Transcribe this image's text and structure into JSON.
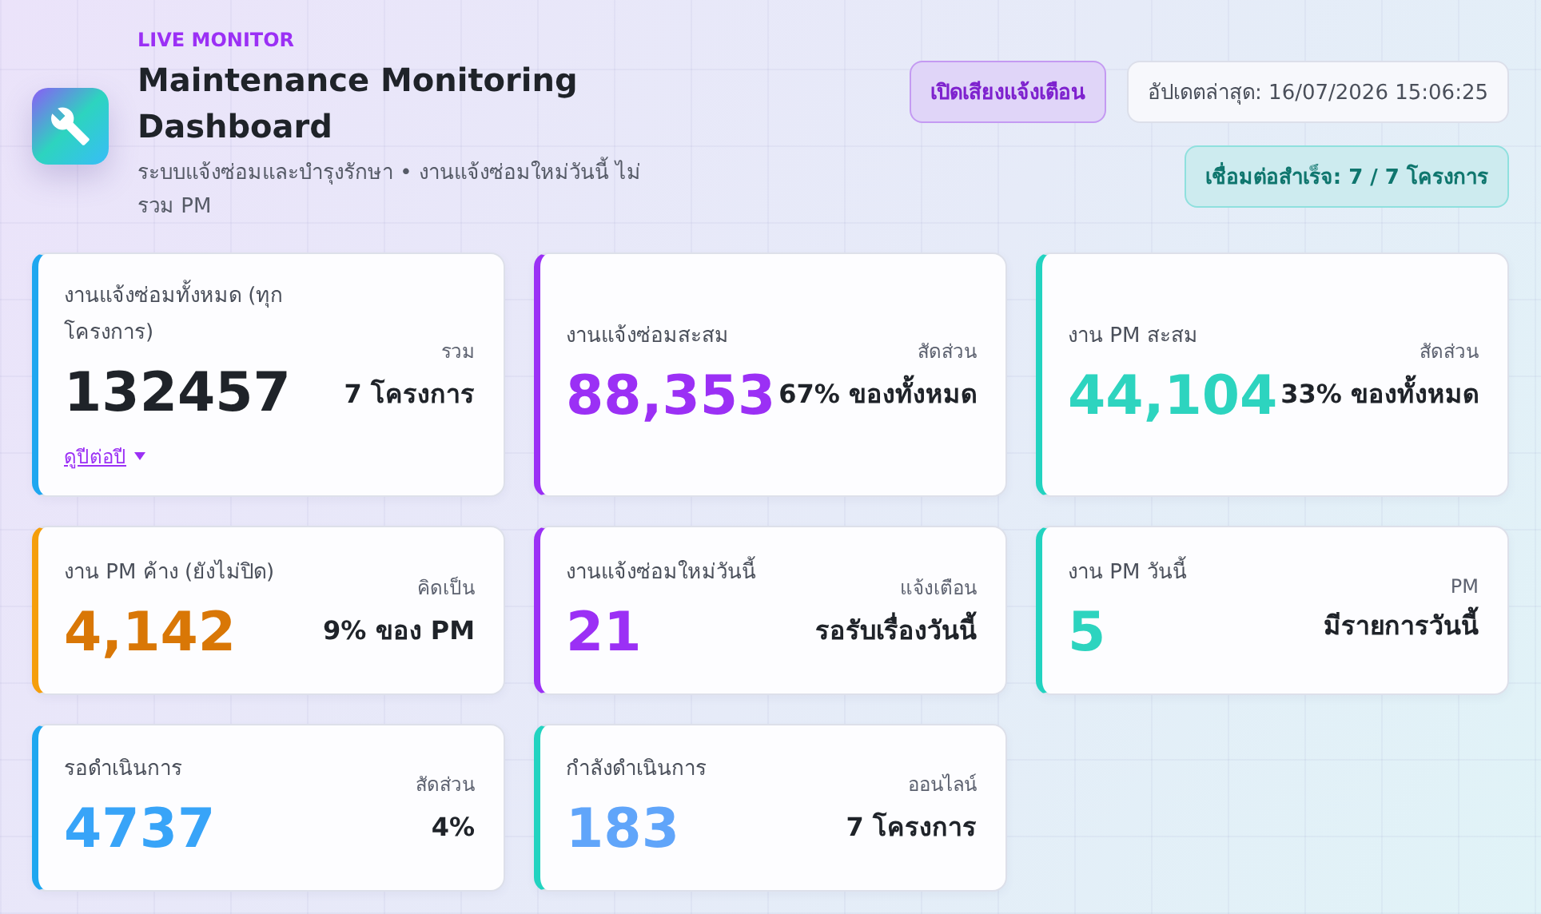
{
  "header": {
    "eyebrow": "LIVE MONITOR",
    "title": "Maintenance Monitoring Dashboard",
    "subtitle": "ระบบแจ้งซ่อมและบำรุงรักษา • งานแจ้งซ่อมใหม่วันนี้ ไม่รวม PM",
    "sound_button": "เปิดเสียงแจ้งเตือน",
    "last_updated": "อัปเดตล่าสุด: 16/07/2026 15:06:25",
    "connection": "เชื่อมต่อสำเร็จ: 7 / 7 โครงการ"
  },
  "cards": [
    {
      "kind": "total",
      "title": "งานแจ้งซ่อมทั้งหมด (ทุกโครงการ)",
      "value": "132457",
      "side_label": "รวม",
      "side_value": "7 โครงการ",
      "color": "#1ea7f0",
      "link": "ดูปีต่อปี"
    },
    {
      "kind": "repair",
      "title": "งานแจ้งซ่อมสะสม",
      "value": "88,353",
      "side_label": "สัดส่วน",
      "side_value": "67% ของทั้งหมด",
      "color": "#9b30f5"
    },
    {
      "kind": "pm",
      "title": "งาน PM สะสม",
      "value": "44,104",
      "side_label": "สัดส่วน",
      "side_value": "33% ของทั้งหมด",
      "color": "#22d3c0"
    },
    {
      "kind": "overdue",
      "title": "งาน PM ค้าง (ยังไม่ปิด)",
      "value": "4,142",
      "side_label": "คิดเป็น",
      "side_value": "9% ของ PM",
      "color": "#f59e0b"
    },
    {
      "kind": "repair",
      "title": "งานแจ้งซ่อมใหม่วันนี้",
      "value": "21",
      "side_label": "แจ้งเตือน",
      "side_value": "รอรับเรื่องวันนี้",
      "color": "#9b30f5"
    },
    {
      "kind": "pm",
      "title": "งาน PM วันนี้",
      "value": "5",
      "side_label": "PM",
      "side_value": "มีรายการวันนี้",
      "color": "#22d3c0"
    },
    {
      "kind": "waiting",
      "title": "รอดำเนินการ",
      "value": "4737",
      "side_label": "สัดส่วน",
      "side_value": "4%",
      "color": "#1ea7f0"
    },
    {
      "kind": "progress",
      "title": "กำลังดำเนินการ",
      "value": "183",
      "side_label": "ออนไลน์",
      "side_value": "7 โครงการ",
      "color": "#22d3c0"
    }
  ]
}
